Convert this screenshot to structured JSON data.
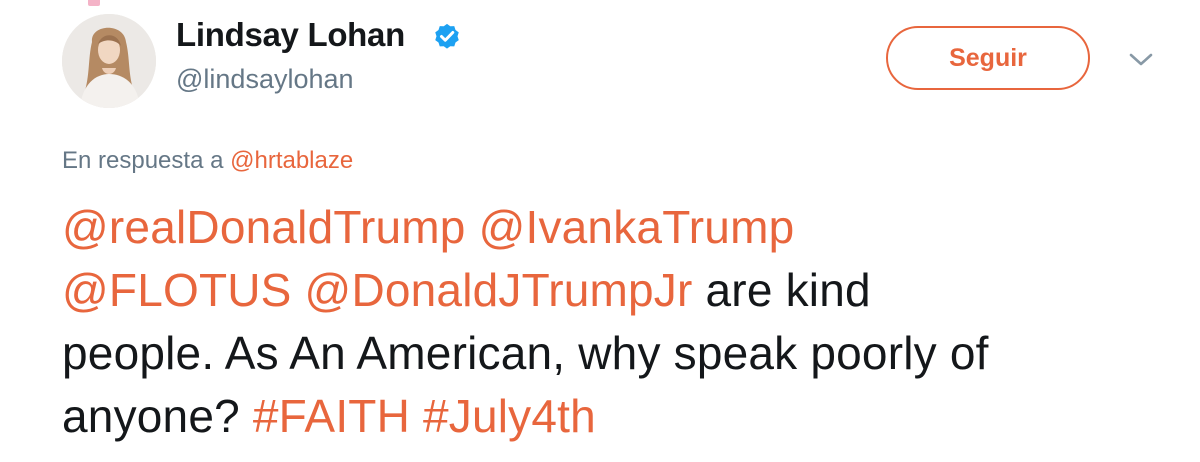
{
  "user": {
    "display_name": "Lindsay Lohan",
    "screen_name": "@lindsaylohan",
    "verified": true
  },
  "actions": {
    "follow_label": "Seguir",
    "more_icon": "chevron-down-icon"
  },
  "reply": {
    "prefix": "En respuesta a",
    "mention": "@hrtablaze"
  },
  "tweet": {
    "line1": {
      "m1": "@realDonaldTrump",
      "m2": "@IvankaTrump"
    },
    "line2": {
      "m1": "@FLOTUS",
      "m2": "@DonaldJTrumpJr",
      "text": "are kind"
    },
    "line3": {
      "text": "people. As An American, why speak poorly of"
    },
    "line4": {
      "text": "anyone?",
      "h1": "#FAITH",
      "h2": "#July4th"
    }
  },
  "colors": {
    "accent": "#e8663d",
    "verified": "#1da1f2",
    "secondary_text": "#657786",
    "primary_text": "#14171a"
  }
}
